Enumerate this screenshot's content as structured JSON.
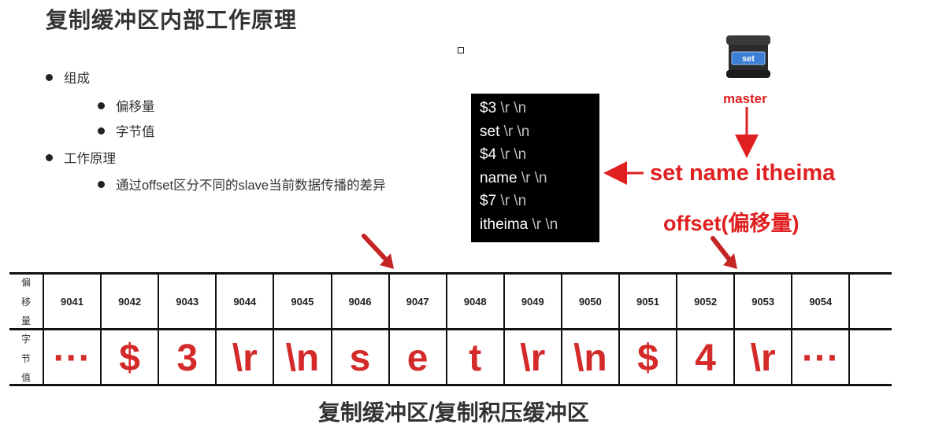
{
  "title": "复制缓冲区内部工作原理",
  "bullets": [
    {
      "level": 1,
      "text": "组成"
    },
    {
      "level": 2,
      "text": "偏移量"
    },
    {
      "level": 2,
      "text": "字节值"
    },
    {
      "level": 1,
      "text": "工作原理"
    },
    {
      "level": 2,
      "text": "通过offset区分不同的slave当前数据传播的差异"
    }
  ],
  "terminal": [
    {
      "main": "$3",
      "esc": "\\r \\n"
    },
    {
      "main": "set",
      "esc": "\\r \\n"
    },
    {
      "main": "$4",
      "esc": "\\r \\n"
    },
    {
      "main": "name",
      "esc": "\\r \\n"
    },
    {
      "main": "$7",
      "esc": "\\r \\n"
    },
    {
      "main": "itheima",
      "esc": "\\r \\n"
    }
  ],
  "server": {
    "badge": "set",
    "label": "master"
  },
  "command": "set name itheima",
  "offset_label": "offset(偏移量)",
  "buffer": {
    "offset_label": [
      "偏",
      "移",
      "量"
    ],
    "byte_label": [
      "字",
      "节",
      "值"
    ],
    "offsets": [
      "9041",
      "9042",
      "9043",
      "9044",
      "9045",
      "9046",
      "9047",
      "9048",
      "9049",
      "9050",
      "9051",
      "9052",
      "9053",
      "9054"
    ],
    "bytes": [
      "···",
      "$",
      "3",
      "\\r",
      "\\n",
      "s",
      "e",
      "t",
      "\\r",
      "\\n",
      "$",
      "4",
      "\\r",
      "···"
    ]
  },
  "caption": "复制缓冲区/复制积压缓冲区",
  "colors": {
    "accent": "#e02020",
    "terminal_bg": "#000000"
  }
}
